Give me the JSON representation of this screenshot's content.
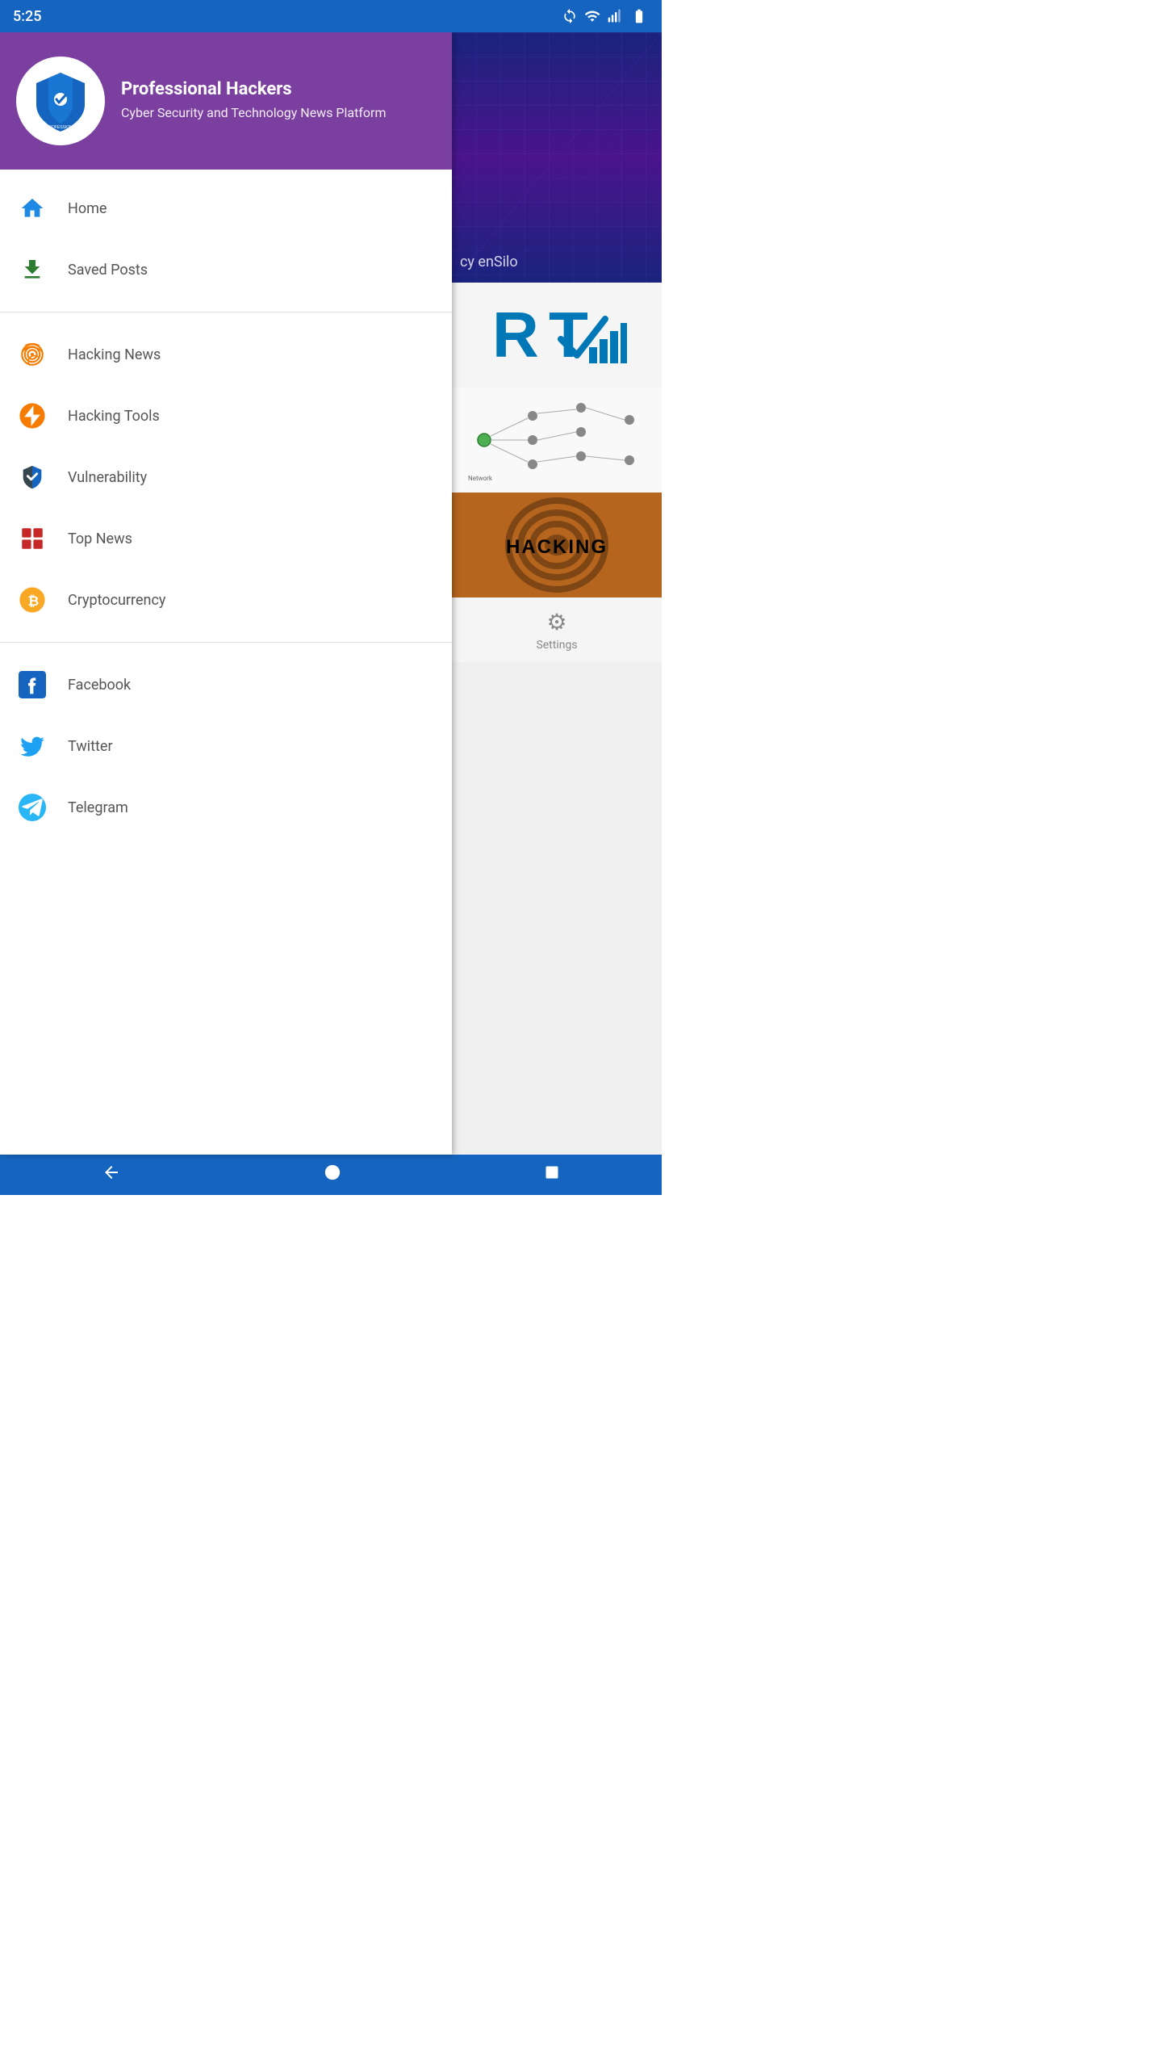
{
  "statusBar": {
    "time": "5:25",
    "icons": [
      "sync-icon",
      "wifi-icon",
      "signal-icon",
      "battery-icon"
    ]
  },
  "drawer": {
    "header": {
      "appName": "Professional Hackers",
      "subtitle": "Cyber Security and Technology News Platform"
    },
    "navItems": [
      {
        "id": "home",
        "label": "Home",
        "icon": "home",
        "section": "main"
      },
      {
        "id": "saved-posts",
        "label": "Saved Posts",
        "icon": "download",
        "section": "main"
      },
      {
        "id": "hacking-news",
        "label": "Hacking News",
        "icon": "fingerprint",
        "section": "categories"
      },
      {
        "id": "hacking-tools",
        "label": "Hacking Tools",
        "icon": "lightning",
        "section": "categories"
      },
      {
        "id": "vulnerability",
        "label": "Vulnerability",
        "icon": "shield",
        "section": "categories"
      },
      {
        "id": "top-news",
        "label": "Top News",
        "icon": "grid",
        "section": "categories"
      },
      {
        "id": "cryptocurrency",
        "label": "Cryptocurrency",
        "icon": "bitcoin",
        "section": "categories"
      },
      {
        "id": "facebook",
        "label": "Facebook",
        "icon": "facebook",
        "section": "social"
      },
      {
        "id": "twitter",
        "label": "Twitter",
        "icon": "twitter",
        "section": "social"
      },
      {
        "id": "telegram",
        "label": "Telegram",
        "icon": "telegram",
        "section": "social"
      }
    ]
  },
  "mainContent": {
    "carouselText": "cy enSilo",
    "settingsLabel": "Settings"
  },
  "bottomNav": {
    "back": "◄",
    "home": "●",
    "recent": "■"
  }
}
